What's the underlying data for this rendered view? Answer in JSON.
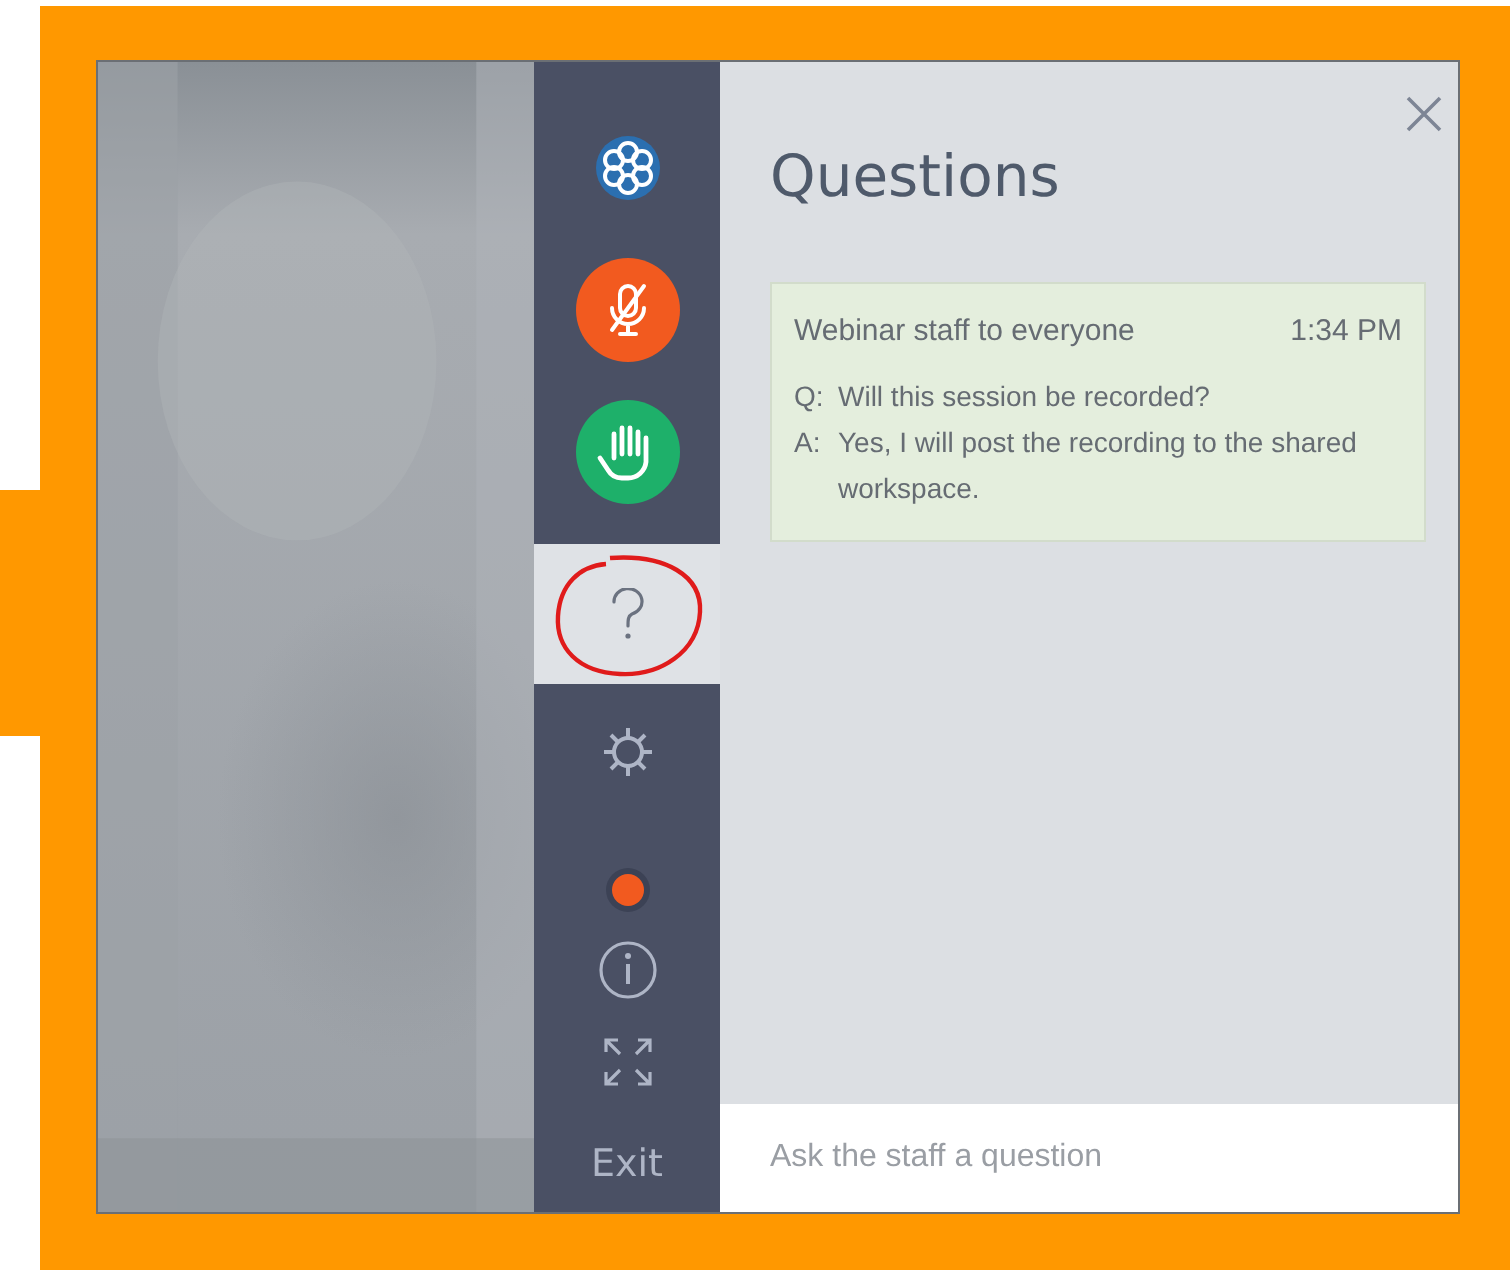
{
  "sidebar": {
    "items": [
      {
        "kind": "logo",
        "selected": false
      },
      {
        "kind": "microphone",
        "selected": false,
        "muted": true
      },
      {
        "kind": "hand",
        "selected": false
      },
      {
        "kind": "questions",
        "selected": true
      },
      {
        "kind": "settings",
        "selected": false
      },
      {
        "kind": "record",
        "selected": false
      },
      {
        "kind": "info",
        "selected": false
      },
      {
        "kind": "fullscreen",
        "selected": false
      },
      {
        "kind": "exit",
        "selected": false,
        "label": "Exit"
      }
    ]
  },
  "panel": {
    "title": "Questions",
    "messages": [
      {
        "sender": "Webinar staff to everyone",
        "time": "1:34 PM",
        "question_prefix": "Q:",
        "question": "Will this session be recorded?",
        "answer_prefix": "A:",
        "answer": "Yes, I will post the recording to the shared workspace."
      }
    ],
    "input": {
      "placeholder": "Ask the staff a question"
    }
  }
}
